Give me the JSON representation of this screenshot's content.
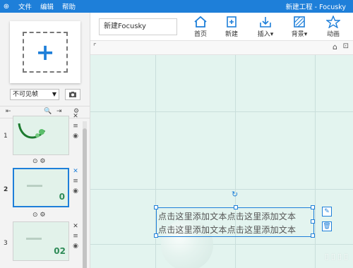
{
  "titlebar": {
    "menu": [
      "文件",
      "编辑",
      "帮助"
    ],
    "title": "新建工程 - Focusky"
  },
  "toolbar": {
    "doc_name": "新建Focusky",
    "tools": [
      {
        "label": "首页",
        "icon": "home-icon"
      },
      {
        "label": "新建",
        "icon": "new-file-icon"
      },
      {
        "label": "插入▾",
        "icon": "insert-icon"
      },
      {
        "label": "背景▾",
        "icon": "background-icon"
      },
      {
        "label": "动画",
        "icon": "animation-icon"
      }
    ]
  },
  "left_panel": {
    "add_frame_symbol": "+",
    "visibility": "不可见帧",
    "slides": [
      {
        "num": "1",
        "number_label": ""
      },
      {
        "num": "2",
        "number_label": "0"
      },
      {
        "num": "3",
        "number_label": "02"
      }
    ]
  },
  "canvas": {
    "text_line1": "点击这里添加文本点击这里添加文本",
    "text_line2": "点击这里添加文本点击这里添加文本"
  },
  "colors": {
    "accent": "#1e7fd9",
    "canvas_bg": "#e3f4ef"
  }
}
